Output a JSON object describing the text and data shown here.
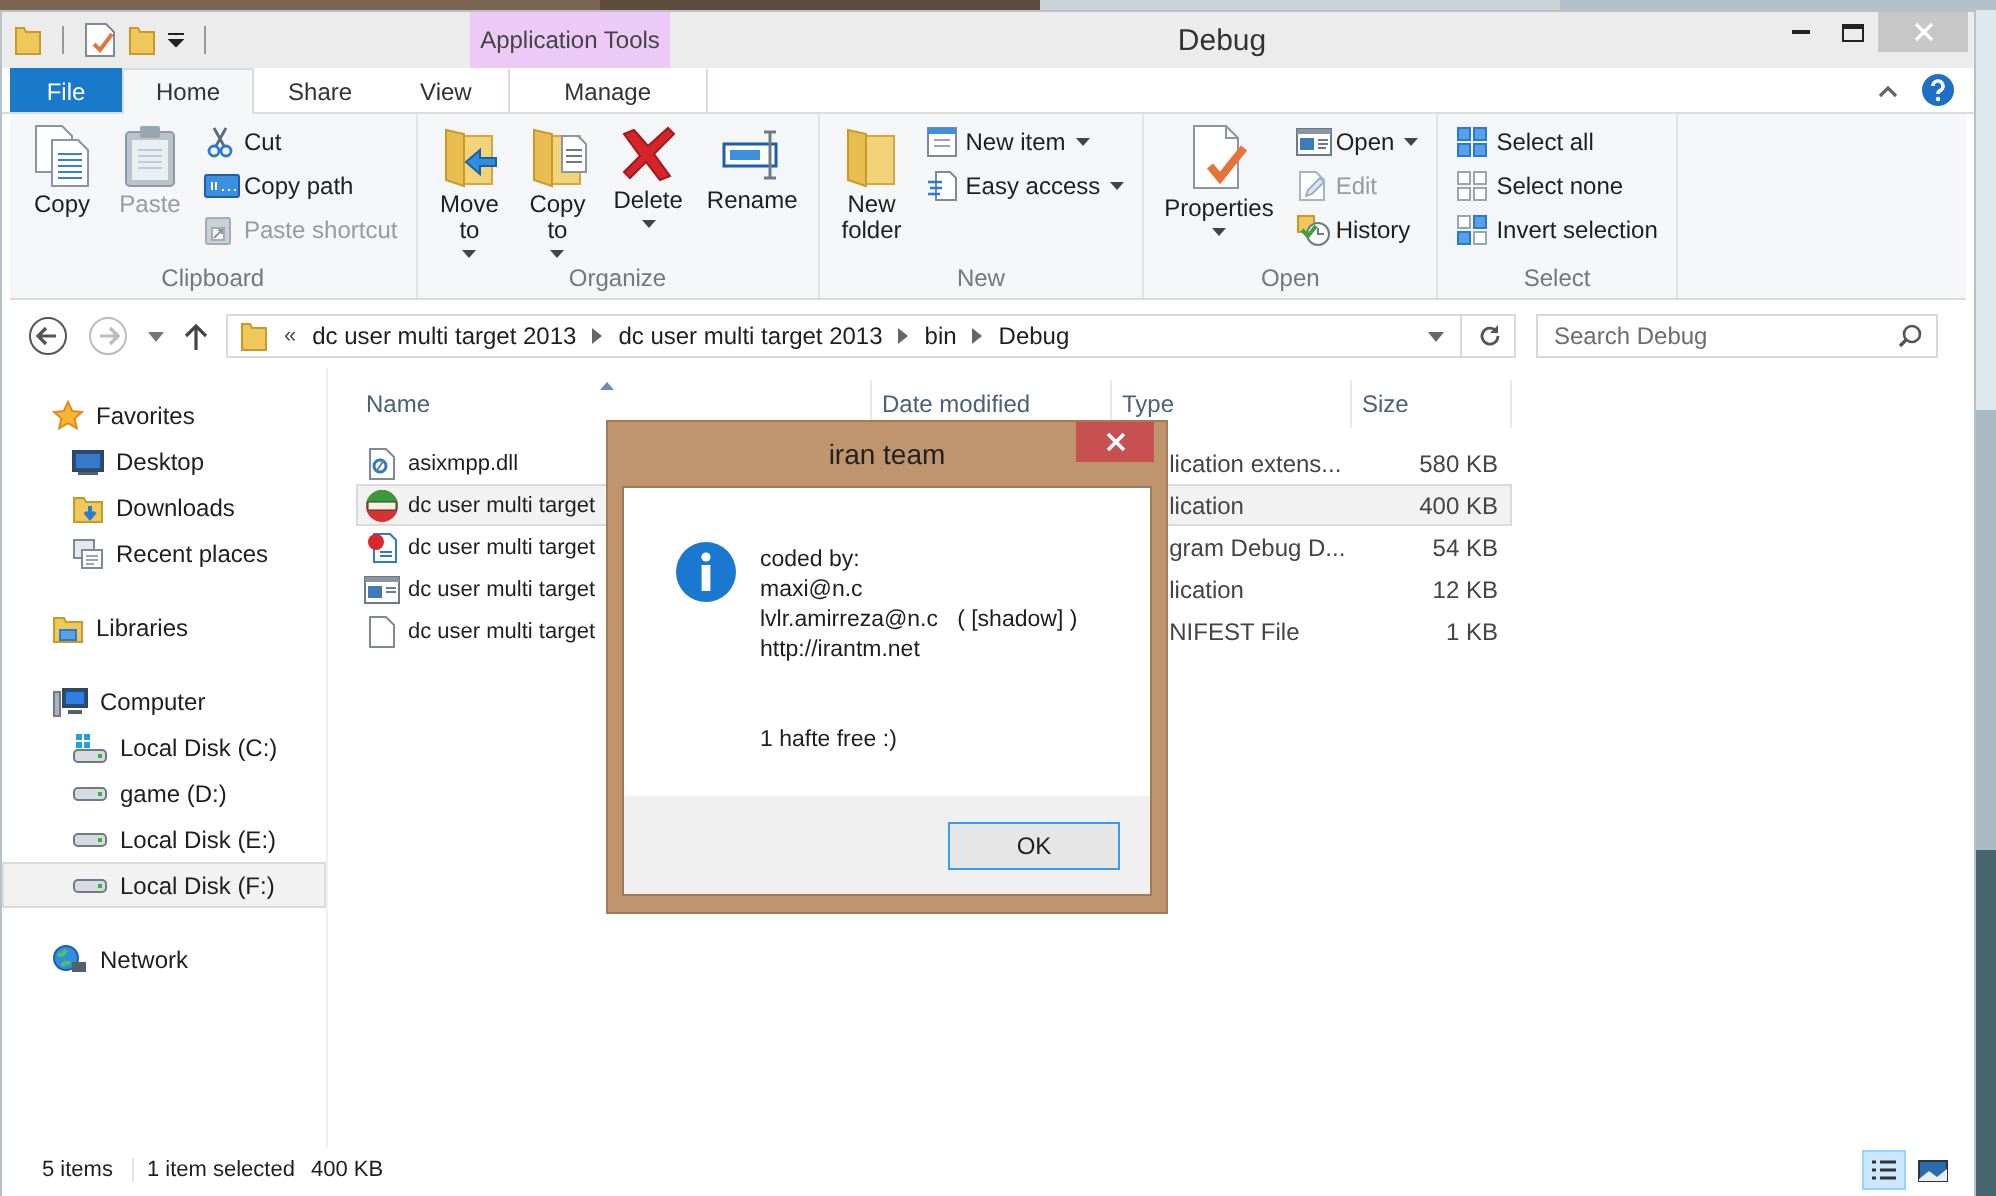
{
  "window": {
    "title": "Debug",
    "context_group": "Application Tools"
  },
  "ribbon_tabs": [
    {
      "label": "File",
      "kind": "file",
      "selected": false
    },
    {
      "label": "Home",
      "kind": "tab",
      "selected": true
    },
    {
      "label": "Share",
      "kind": "tab",
      "selected": false
    },
    {
      "label": "View",
      "kind": "tab",
      "selected": false
    },
    {
      "label": "Manage",
      "kind": "context",
      "selected": false
    }
  ],
  "ribbon_groups": [
    {
      "label": "Clipboard",
      "items": [
        {
          "kind": "large",
          "label": "Copy",
          "disabled": false,
          "menu": false
        },
        {
          "kind": "large",
          "label": "Paste",
          "disabled": true,
          "menu": false
        },
        {
          "kind": "small",
          "label": "Cut",
          "disabled": false,
          "menu": false
        },
        {
          "kind": "small",
          "label": "Copy path",
          "disabled": false,
          "menu": false
        },
        {
          "kind": "small",
          "label": "Paste shortcut",
          "disabled": true,
          "menu": false
        }
      ]
    },
    {
      "label": "Organize",
      "items": [
        {
          "kind": "large",
          "label": "Move\nto",
          "disabled": false,
          "menu": true
        },
        {
          "kind": "large",
          "label": "Copy\nto",
          "disabled": false,
          "menu": true
        },
        {
          "kind": "large",
          "label": "Delete",
          "disabled": false,
          "menu": true
        },
        {
          "kind": "large",
          "label": "Rename",
          "disabled": false,
          "menu": false
        }
      ]
    },
    {
      "label": "New",
      "items": [
        {
          "kind": "large",
          "label": "New\nfolder",
          "disabled": false,
          "menu": false
        },
        {
          "kind": "small",
          "label": "New item",
          "disabled": false,
          "menu": true
        },
        {
          "kind": "small",
          "label": "Easy access",
          "disabled": false,
          "menu": true
        }
      ]
    },
    {
      "label": "Open",
      "items": [
        {
          "kind": "large",
          "label": "Properties",
          "disabled": false,
          "menu": true
        },
        {
          "kind": "small",
          "label": "Open",
          "disabled": false,
          "menu": true
        },
        {
          "kind": "small",
          "label": "Edit",
          "disabled": true,
          "menu": false
        },
        {
          "kind": "small",
          "label": "History",
          "disabled": false,
          "menu": false
        }
      ]
    },
    {
      "label": "Select",
      "items": [
        {
          "kind": "small",
          "label": "Select all",
          "disabled": false,
          "menu": false
        },
        {
          "kind": "small",
          "label": "Select none",
          "disabled": false,
          "menu": false
        },
        {
          "kind": "small",
          "label": "Invert selection",
          "disabled": false,
          "menu": false
        }
      ]
    }
  ],
  "address_bar": {
    "overflow": "«",
    "breadcrumbs": [
      "dc user multi target 2013",
      "dc user multi target 2013",
      "bin",
      "Debug"
    ]
  },
  "search": {
    "placeholder": "Search Debug"
  },
  "nav_pane": [
    {
      "label": "Favorites",
      "selected": false,
      "children": [
        {
          "label": "Desktop",
          "selected": false
        },
        {
          "label": "Downloads",
          "selected": false
        },
        {
          "label": "Recent places",
          "selected": false
        }
      ]
    },
    {
      "label": "Libraries",
      "selected": false
    },
    {
      "label": "Computer",
      "selected": false,
      "children": [
        {
          "label": "Local Disk (C:)",
          "selected": false
        },
        {
          "label": "game (D:)",
          "selected": false
        },
        {
          "label": "Local Disk (E:)",
          "selected": false
        },
        {
          "label": "Local Disk (F:)",
          "selected": true
        }
      ]
    },
    {
      "label": "Network",
      "selected": false
    }
  ],
  "file_list": {
    "columns": [
      "Name",
      "Date modified",
      "Type",
      "Size"
    ],
    "rows": [
      {
        "name": "asixmpp.dll",
        "type": "lication extens...",
        "size": "580 KB",
        "selected": false
      },
      {
        "name": "dc user multi target",
        "type": "lication",
        "size": "400 KB",
        "selected": true
      },
      {
        "name": "dc user multi target",
        "type": "gram Debug D...",
        "size": "54 KB",
        "selected": false
      },
      {
        "name": "dc user multi target",
        "type": "lication",
        "size": "12 KB",
        "selected": false
      },
      {
        "name": "dc user multi target",
        "type": "NIFEST File",
        "size": "1 KB",
        "selected": false
      }
    ]
  },
  "status_bar": {
    "items": [
      "5 items",
      "1 item selected",
      "400 KB"
    ],
    "views": [
      {
        "kind": "details",
        "selected": true
      },
      {
        "kind": "large_icons",
        "selected": false
      }
    ]
  },
  "dialog": {
    "title": "iran team",
    "message": "coded by:\nmaxi@n.c\nlvlr.amirreza@n.c   ( [shadow] )\nhttp://irantm.net\n\n\n1 hafte free :)",
    "button": "OK"
  }
}
